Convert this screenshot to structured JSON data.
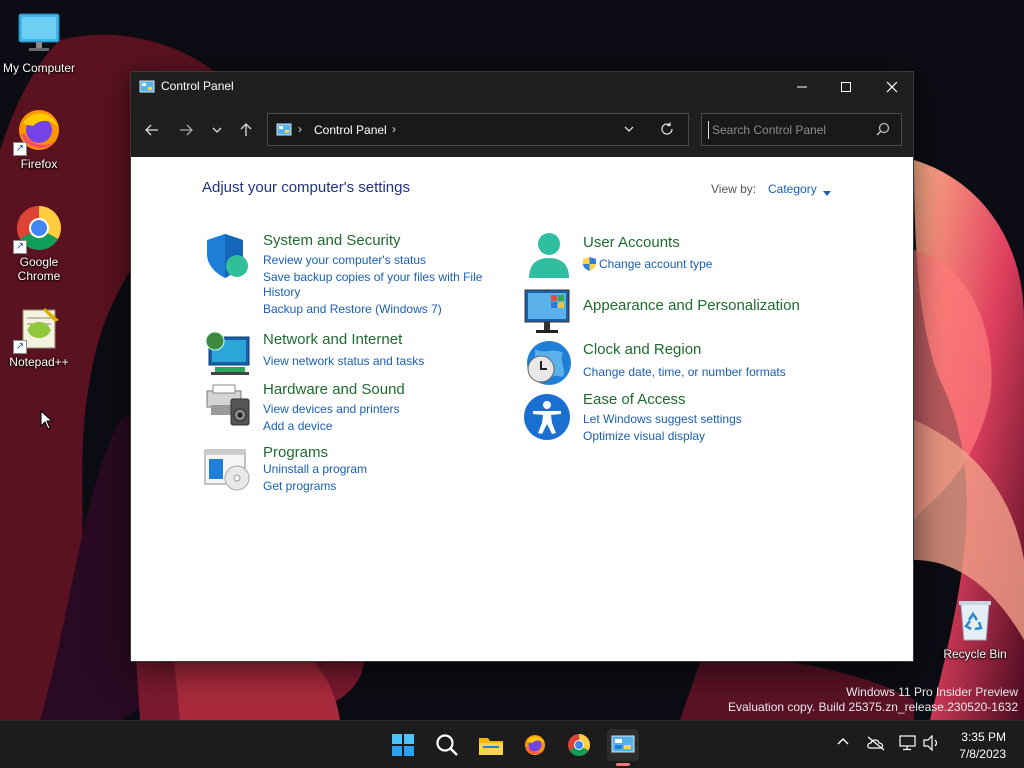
{
  "desktop": {
    "icons": [
      {
        "label": "My Computer",
        "icon": "monitor-icon"
      },
      {
        "label": "Firefox",
        "icon": "firefox-icon"
      },
      {
        "label": "Google\nChrome",
        "icon": "chrome-icon"
      },
      {
        "label": "Notepad++",
        "icon": "notepadpp-icon"
      },
      {
        "label": "Recycle Bin",
        "icon": "recycle-bin-icon"
      }
    ]
  },
  "window": {
    "title": "Control Panel",
    "address": {
      "crumb": "Control Panel"
    },
    "search": {
      "placeholder": "Search Control Panel"
    },
    "heading": "Adjust your computer's settings",
    "view_by": {
      "label": "View by:",
      "value": "Category"
    },
    "categories_left": [
      {
        "title": "System and Security",
        "icon": "shield-icon",
        "links": [
          "Review your computer's status",
          "Save backup copies of your files with File",
          "History",
          "Backup and Restore (Windows 7)"
        ]
      },
      {
        "title": "Network and Internet",
        "icon": "network-globe-icon",
        "links": [
          "View network status and tasks"
        ]
      },
      {
        "title": "Hardware and Sound",
        "icon": "printer-speaker-icon",
        "links": [
          "View devices and printers",
          "Add a device"
        ]
      },
      {
        "title": "Programs",
        "icon": "programs-disc-icon",
        "links": [
          "Uninstall a program",
          "Get programs"
        ]
      }
    ],
    "categories_right": [
      {
        "title": "User Accounts",
        "icon": "user-icon",
        "links": [
          "Change account type"
        ]
      },
      {
        "title": "Appearance and Personalization",
        "icon": "monitor-tiles-icon",
        "links": []
      },
      {
        "title": "Clock and Region",
        "icon": "clock-globe-icon",
        "links": [
          "Change date, time, or number formats"
        ]
      },
      {
        "title": "Ease of Access",
        "icon": "accessibility-icon",
        "links": [
          "Let Windows suggest settings",
          "Optimize visual display"
        ]
      }
    ]
  },
  "watermark": {
    "line1": "Windows 11 Pro Insider Preview",
    "line2": "Evaluation copy. Build 25375.zn_release.230520-1632"
  },
  "taskbar": {
    "items": [
      "start-icon",
      "search-icon",
      "file-explorer-icon",
      "firefox-icon",
      "chrome-icon",
      "control-panel-icon"
    ],
    "tray": [
      "chevron-up-icon",
      "onedrive-off-icon",
      "network-icon",
      "volume-icon"
    ],
    "time": "3:35 PM",
    "date": "7/8/2023"
  },
  "colors": {
    "title_bar": "#1f1f1f",
    "category_title": "#1f6b2f",
    "link": "#1a5fb4",
    "heading": "#1e3287",
    "taskbar": "#1c1c1c"
  }
}
